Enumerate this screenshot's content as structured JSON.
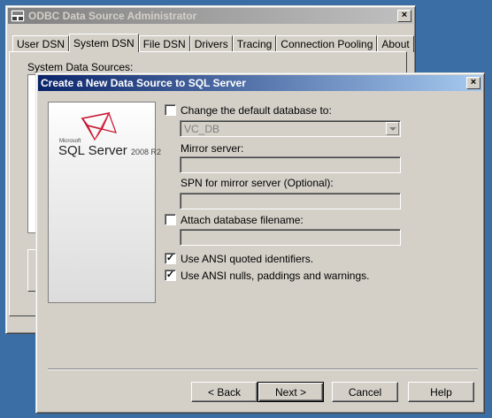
{
  "odbc": {
    "title": "ODBC Data Source Administrator",
    "close": "×",
    "tabs": [
      "User DSN",
      "System DSN",
      "File DSN",
      "Drivers",
      "Tracing",
      "Connection Pooling",
      "About"
    ],
    "selected_tab": "System DSN",
    "section_label": "System Data Sources:"
  },
  "wizard": {
    "title": "Create a New Data Source to SQL Server",
    "close": "×",
    "logo": {
      "small": "Microsoft",
      "product": "SQL Server",
      "version": "2008 R2"
    },
    "change_db": {
      "label": "Change the default database to:",
      "checked": false
    },
    "database_value": "VC_DB",
    "mirror_label": "Mirror server:",
    "mirror_value": "",
    "spn_label": "SPN for mirror server (Optional):",
    "spn_value": "",
    "attach": {
      "label": "Attach database filename:",
      "checked": false
    },
    "attach_value": "",
    "ansi_quoted": {
      "label": "Use ANSI quoted identifiers.",
      "checked": true
    },
    "ansi_nulls": {
      "label": "Use ANSI nulls, paddings and warnings.",
      "checked": true
    },
    "buttons": {
      "back": "< Back",
      "next": "Next >",
      "cancel": "Cancel",
      "help": "Help"
    }
  }
}
